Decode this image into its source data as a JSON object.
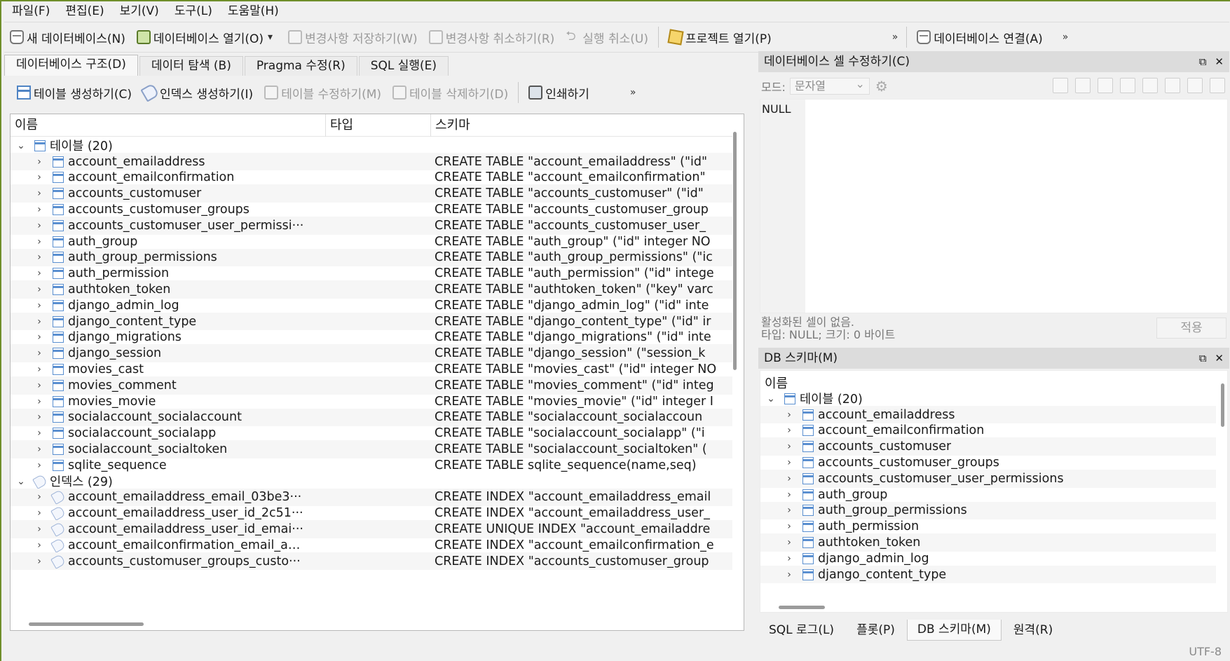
{
  "menu": [
    "파일(F)",
    "편집(E)",
    "보기(V)",
    "도구(L)",
    "도움말(H)"
  ],
  "toolbar": {
    "new_db": "새 데이터베이스(N)",
    "open_db": "데이터베이스 열기(O)",
    "save_changes": "변경사항 저장하기(W)",
    "revert_changes": "변경사항 취소하기(R)",
    "undo": "실행 취소(U)",
    "open_project": "프로젝트 열기(P)",
    "attach_db": "데이터베이스 연결(A)",
    "more": "»"
  },
  "tabs": [
    "데이터베이스 구조(D)",
    "데이터 탐색 (B)",
    "Pragma 수정(R)",
    "SQL 실행(E)"
  ],
  "structure_toolbar": {
    "create_table": "테이블 생성하기(C)",
    "create_index": "인덱스 생성하기(I)",
    "modify_table": "테이블 수정하기(M)",
    "delete_table": "테이블 삭제하기(D)",
    "print": "인쇄하기",
    "more": "»"
  },
  "tree": {
    "columns": [
      "이름",
      "타입",
      "스키마"
    ],
    "tables_label": "테이블 (20)",
    "tables": [
      {
        "name": "account_emailaddress",
        "schema": "CREATE TABLE \"account_emailaddress\" (\"id\""
      },
      {
        "name": "account_emailconfirmation",
        "schema": "CREATE TABLE \"account_emailconfirmation\""
      },
      {
        "name": "accounts_customuser",
        "schema": "CREATE TABLE \"accounts_customuser\" (\"id\""
      },
      {
        "name": "accounts_customuser_groups",
        "schema": "CREATE TABLE \"accounts_customuser_group"
      },
      {
        "name": "accounts_customuser_user_permissi···",
        "schema": "CREATE TABLE \"accounts_customuser_user_"
      },
      {
        "name": "auth_group",
        "schema": "CREATE TABLE \"auth_group\" (\"id\" integer NO"
      },
      {
        "name": "auth_group_permissions",
        "schema": "CREATE TABLE \"auth_group_permissions\" (\"ic"
      },
      {
        "name": "auth_permission",
        "schema": "CREATE TABLE \"auth_permission\" (\"id\" intege"
      },
      {
        "name": "authtoken_token",
        "schema": "CREATE TABLE \"authtoken_token\" (\"key\" varc"
      },
      {
        "name": "django_admin_log",
        "schema": "CREATE TABLE \"django_admin_log\" (\"id\" inte"
      },
      {
        "name": "django_content_type",
        "schema": "CREATE TABLE \"django_content_type\" (\"id\" ir"
      },
      {
        "name": "django_migrations",
        "schema": "CREATE TABLE \"django_migrations\" (\"id\" inte"
      },
      {
        "name": "django_session",
        "schema": "CREATE TABLE \"django_session\" (\"session_k"
      },
      {
        "name": "movies_cast",
        "schema": "CREATE TABLE \"movies_cast\" (\"id\" integer NO"
      },
      {
        "name": "movies_comment",
        "schema": "CREATE TABLE \"movies_comment\" (\"id\" integ"
      },
      {
        "name": "movies_movie",
        "schema": "CREATE TABLE \"movies_movie\" (\"id\" integer I"
      },
      {
        "name": "socialaccount_socialaccount",
        "schema": "CREATE TABLE \"socialaccount_socialaccoun"
      },
      {
        "name": "socialaccount_socialapp",
        "schema": "CREATE TABLE \"socialaccount_socialapp\" (\"i"
      },
      {
        "name": "socialaccount_socialtoken",
        "schema": "CREATE TABLE \"socialaccount_socialtoken\" ("
      },
      {
        "name": "sqlite_sequence",
        "schema": "CREATE TABLE sqlite_sequence(name,seq)"
      }
    ],
    "indexes_label": "인덱스 (29)",
    "indexes": [
      {
        "name": "account_emailaddress_email_03be3···",
        "schema": "CREATE INDEX \"account_emailaddress_email"
      },
      {
        "name": "account_emailaddress_user_id_2c51···",
        "schema": "CREATE INDEX \"account_emailaddress_user_"
      },
      {
        "name": "account_emailaddress_user_id_emai···",
        "schema": "CREATE UNIQUE INDEX \"account_emailaddre"
      },
      {
        "name": "account_emailconfirmation_email_ad···",
        "schema": "CREATE INDEX \"account_emailconfirmation_e"
      },
      {
        "name": "accounts_customuser_groups_custo···",
        "schema": "CREATE INDEX \"accounts_customuser_group"
      }
    ]
  },
  "edit_cell": {
    "title": "데이터베이스 셀 수정하기(C)",
    "mode_label": "모드:",
    "mode_value": "문자열",
    "content": "NULL",
    "status_line1": "활성화된 셀이 없음.",
    "status_line2": "타입: NULL; 크기: 0 바이트",
    "apply": "적용"
  },
  "db_schema": {
    "title": "DB 스키마(M)",
    "column": "이름",
    "tables_label": "테이블 (20)",
    "items": [
      "account_emailaddress",
      "account_emailconfirmation",
      "accounts_customuser",
      "accounts_customuser_groups",
      "accounts_customuser_user_permissions",
      "auth_group",
      "auth_group_permissions",
      "auth_permission",
      "authtoken_token",
      "django_admin_log",
      "django_content_type"
    ]
  },
  "bottom_tabs": [
    "SQL 로그(L)",
    "플롯(P)",
    "DB 스키마(M)",
    "원격(R)"
  ],
  "status_bar": {
    "encoding": "UTF-8"
  },
  "panel_buttons": {
    "float": "⧉",
    "close": "✕"
  }
}
